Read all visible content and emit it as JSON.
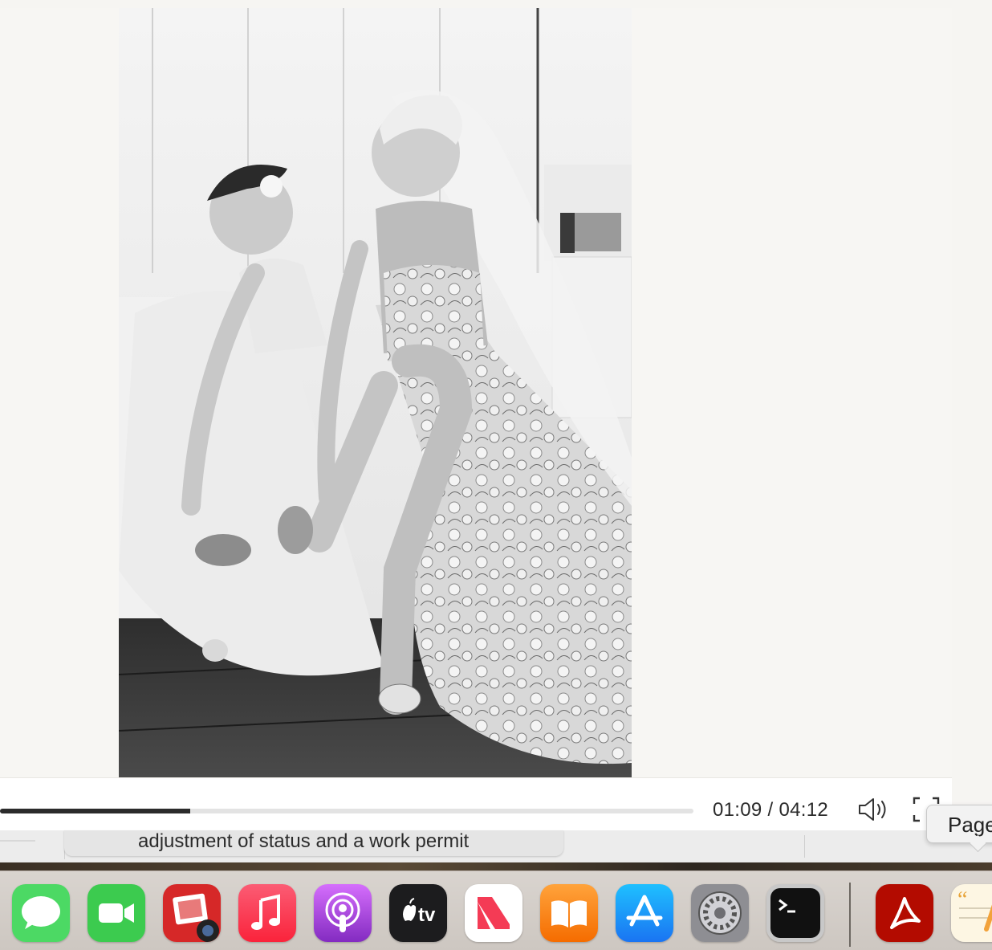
{
  "player": {
    "current_time": "01:09",
    "duration": "04:12",
    "time_readout": "01:09 / 04:12",
    "progress_fraction": 0.274
  },
  "caption": {
    "text": "adjustment of status and a work permit"
  },
  "tooltip": {
    "label": "Page"
  },
  "icons": {
    "volume": "speaker-icon",
    "fullscreen": "fullscreen-icon"
  },
  "dock": {
    "apps": [
      {
        "name": "Messages",
        "icon": "messages-icon"
      },
      {
        "name": "FaceTime",
        "icon": "facetime-icon"
      },
      {
        "name": "Photo Booth",
        "icon": "photo-booth-icon"
      },
      {
        "name": "Music",
        "icon": "music-icon"
      },
      {
        "name": "Podcasts",
        "icon": "podcasts-icon"
      },
      {
        "name": "TV",
        "icon": "apple-tv-icon"
      },
      {
        "name": "News",
        "icon": "news-icon"
      },
      {
        "name": "Books",
        "icon": "books-icon"
      },
      {
        "name": "App Store",
        "icon": "app-store-icon"
      },
      {
        "name": "System Preferences",
        "icon": "system-preferences-icon"
      },
      {
        "name": "Terminal",
        "icon": "terminal-icon"
      },
      {
        "name": "Acrobat Reader",
        "icon": "acrobat-icon"
      },
      {
        "name": "Pages",
        "icon": "pages-icon"
      }
    ],
    "tv_label": "tv"
  },
  "colors": {
    "page_bg": "#f6f5f2",
    "progress_fill": "#2b2b2b",
    "progress_track": "#e3e3e3"
  }
}
